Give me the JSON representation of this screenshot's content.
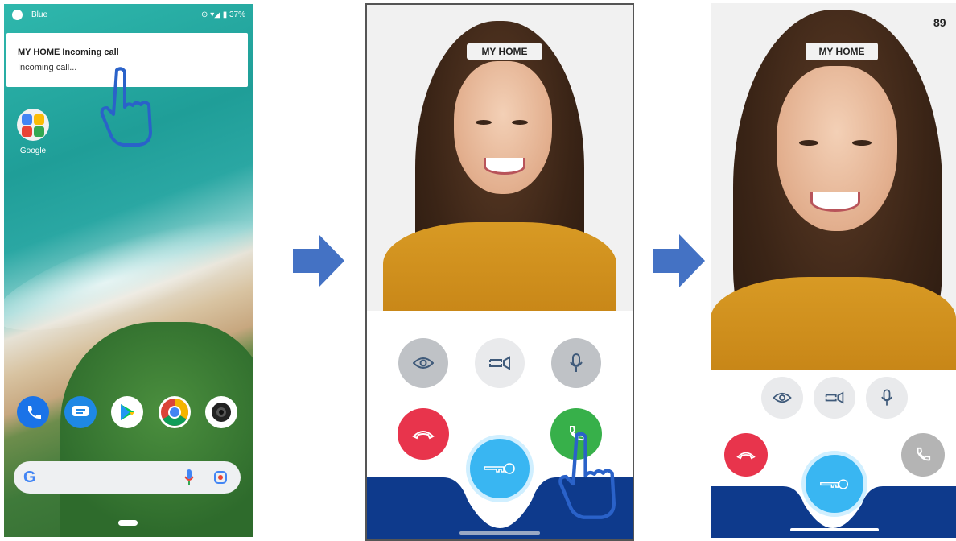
{
  "page_number": "89",
  "phone1": {
    "status": {
      "carrier": "Blue",
      "battery": "37%"
    },
    "notification": {
      "title": "MY HOME Incoming call",
      "text": "Incoming call..."
    },
    "folder_label": "Google",
    "dock": [
      {
        "name": "phone-app-icon",
        "color": "#1a73e8"
      },
      {
        "name": "messages-app-icon",
        "color": "#1e88e5"
      },
      {
        "name": "play-store-app-icon",
        "color": "#ffffff"
      },
      {
        "name": "chrome-app-icon",
        "color": "#ffffff"
      },
      {
        "name": "camera-app-icon",
        "color": "#ffffff"
      }
    ],
    "search": {
      "logo": "G"
    }
  },
  "phone2": {
    "caller_label": "MY HOME",
    "buttons": [
      "eye-icon",
      "switch-camera-icon",
      "microphone-icon",
      "hang-up-icon",
      "answer-icon",
      "key-icon"
    ]
  },
  "phone3": {
    "caller_label": "MY HOME",
    "buttons": [
      "eye-icon",
      "switch-camera-icon",
      "microphone-icon",
      "hang-up-icon",
      "answer-icon",
      "key-icon"
    ]
  },
  "colors": {
    "accent_blue": "#4472c4",
    "navy": "#0e3a8c",
    "red": "#e8344c",
    "green": "#37b04a",
    "key_blue": "#39b6f2"
  }
}
